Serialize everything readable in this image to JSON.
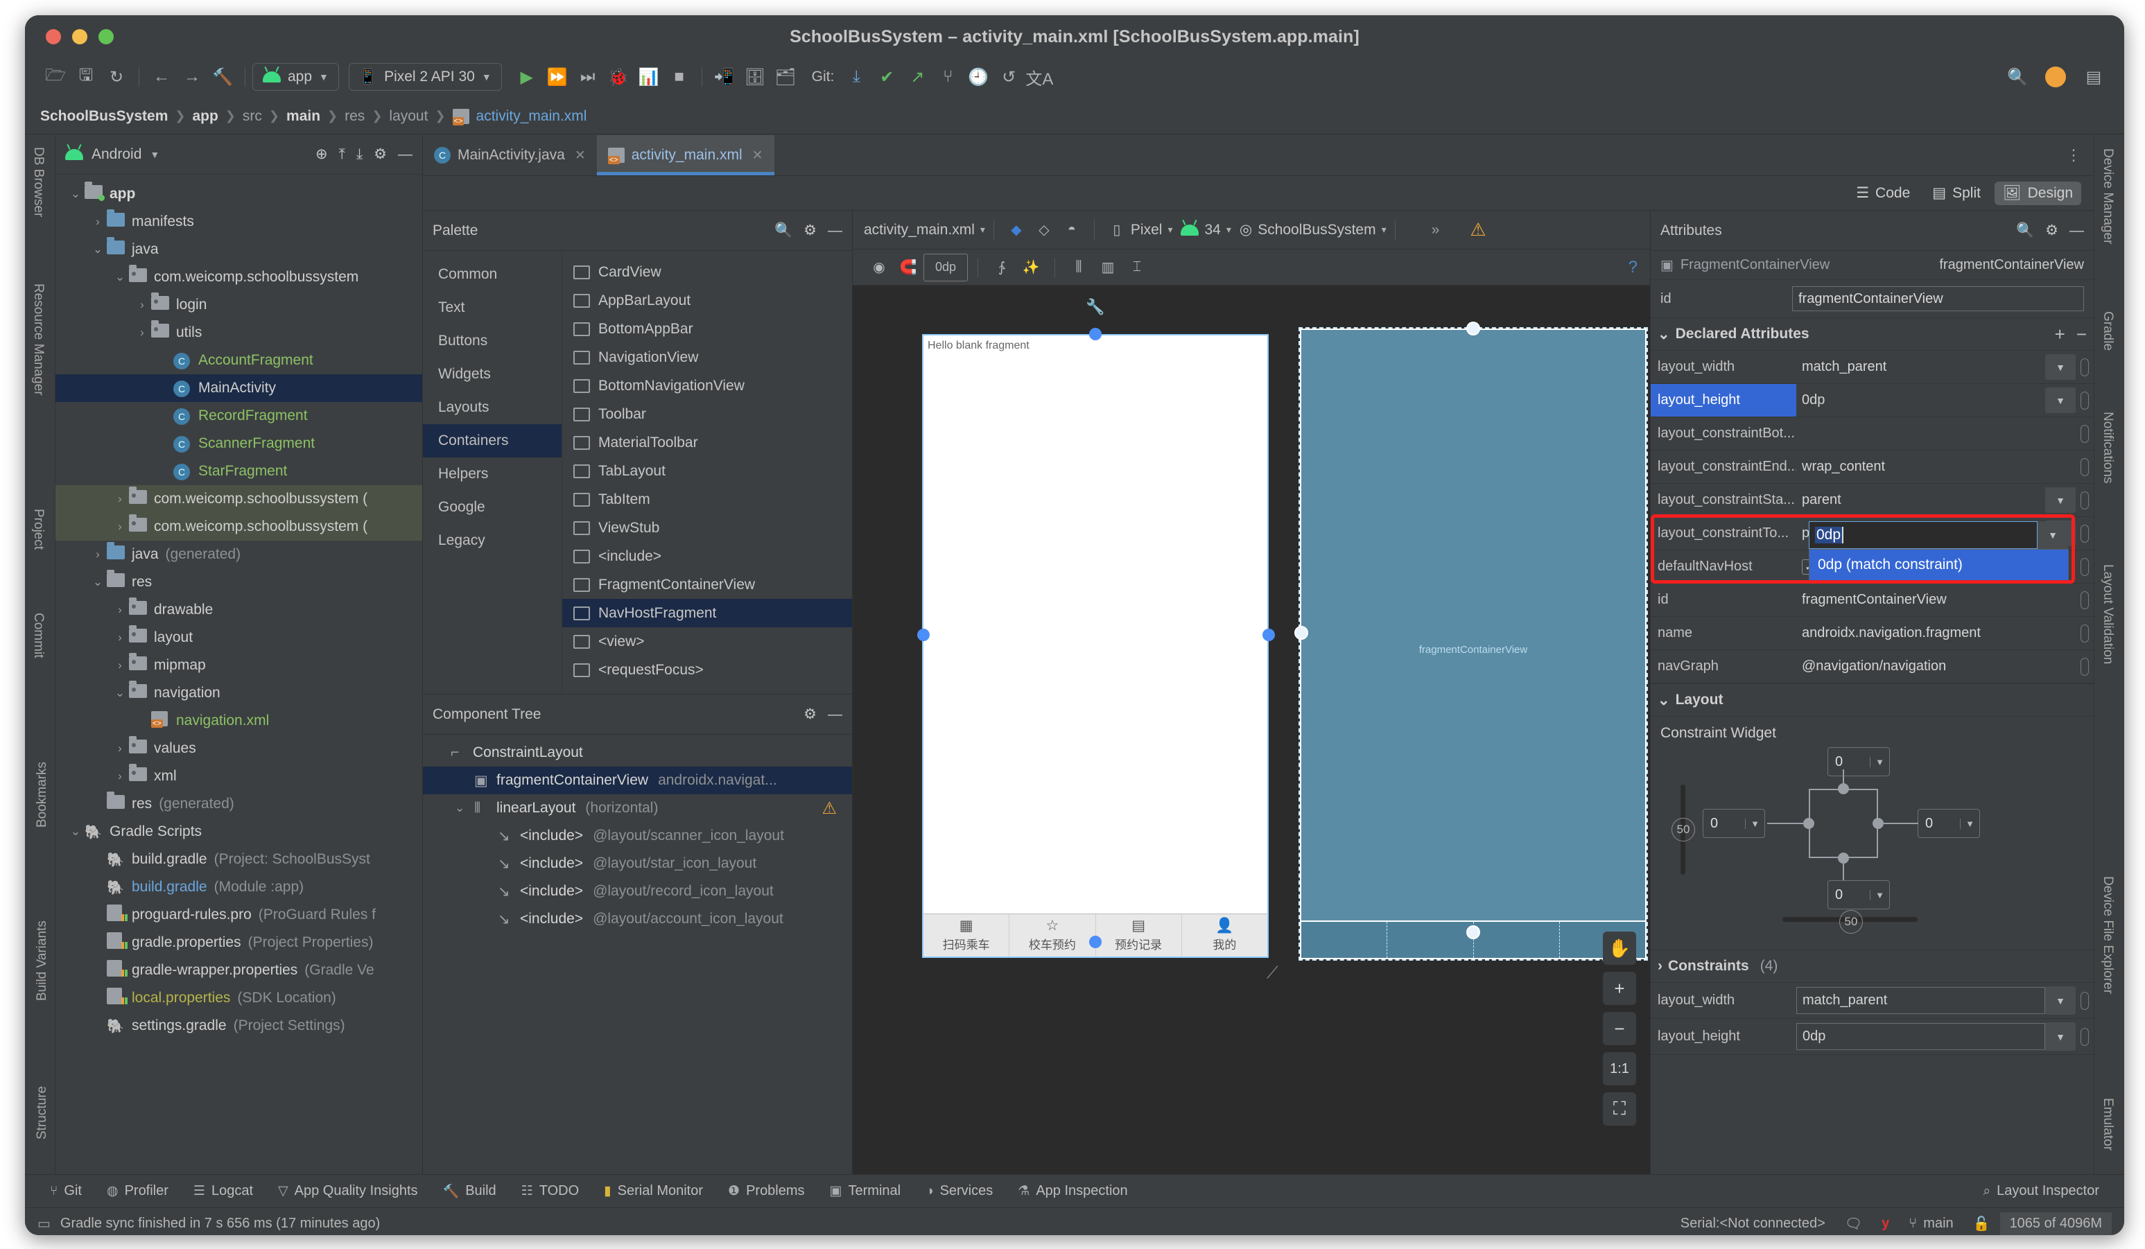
{
  "window": {
    "title": "SchoolBusSystem – activity_main.xml [SchoolBusSystem.app.main]"
  },
  "toolbar": {
    "icons": [
      "open-folder",
      "save",
      "sync"
    ],
    "nav": [
      "back",
      "forward",
      "build"
    ],
    "run_config": "app",
    "device": "Pixel 2 API 30",
    "git_label": "Git:",
    "memory": "1065 of 4096M"
  },
  "breadcrumb": {
    "items": [
      {
        "label": "SchoolBusSystem",
        "style": "bold"
      },
      {
        "label": "app",
        "style": "bold"
      },
      {
        "label": "src",
        "style": "normal"
      },
      {
        "label": "main",
        "style": "bold"
      },
      {
        "label": "res",
        "style": "normal"
      },
      {
        "label": "layout",
        "style": "normal"
      },
      {
        "label": "activity_main.xml",
        "style": "file"
      }
    ]
  },
  "project_panel": {
    "title": "Android",
    "tree": [
      {
        "indent": 0,
        "arrow": "v",
        "icon": "folder-module",
        "label": "app",
        "style": "bold",
        "sel": "none"
      },
      {
        "indent": 1,
        "arrow": ">",
        "icon": "folder",
        "label": "manifests",
        "style": "normal",
        "sel": "none"
      },
      {
        "indent": 1,
        "arrow": "v",
        "icon": "folder",
        "label": "java",
        "style": "normal",
        "sel": "none"
      },
      {
        "indent": 2,
        "arrow": "v",
        "icon": "package",
        "label": "com.weicomp.schoolbussystem",
        "style": "normal",
        "sel": "none"
      },
      {
        "indent": 3,
        "arrow": ">",
        "icon": "package",
        "label": "login",
        "style": "normal",
        "sel": "none"
      },
      {
        "indent": 3,
        "arrow": ">",
        "icon": "package",
        "label": "utils",
        "style": "normal",
        "sel": "none"
      },
      {
        "indent": 4,
        "arrow": "",
        "icon": "class",
        "label": "AccountFragment",
        "style": "green",
        "sel": "none"
      },
      {
        "indent": 4,
        "arrow": "",
        "icon": "class",
        "label": "MainActivity",
        "style": "normal",
        "sel": "blue"
      },
      {
        "indent": 4,
        "arrow": "",
        "icon": "class",
        "label": "RecordFragment",
        "style": "green",
        "sel": "none"
      },
      {
        "indent": 4,
        "arrow": "",
        "icon": "class",
        "label": "ScannerFragment",
        "style": "green",
        "sel": "none"
      },
      {
        "indent": 4,
        "arrow": "",
        "icon": "class",
        "label": "StarFragment",
        "style": "green",
        "sel": "none"
      },
      {
        "indent": 2,
        "arrow": ">",
        "icon": "package",
        "label": "com.weicomp.schoolbussystem (",
        "style": "normal",
        "sel": "green"
      },
      {
        "indent": 2,
        "arrow": ">",
        "icon": "package",
        "label": "com.weicomp.schoolbussystem (",
        "style": "normal",
        "sel": "green"
      },
      {
        "indent": 1,
        "arrow": ">",
        "icon": "folder-gen",
        "label": "java",
        "suffix": "(generated)",
        "style": "normal",
        "sel": "none"
      },
      {
        "indent": 1,
        "arrow": "v",
        "icon": "folder-res",
        "label": "res",
        "style": "normal",
        "sel": "none"
      },
      {
        "indent": 2,
        "arrow": ">",
        "icon": "package",
        "label": "drawable",
        "style": "normal",
        "sel": "none"
      },
      {
        "indent": 2,
        "arrow": ">",
        "icon": "package",
        "label": "layout",
        "style": "normal",
        "sel": "none"
      },
      {
        "indent": 2,
        "arrow": ">",
        "icon": "package",
        "label": "mipmap",
        "style": "normal",
        "sel": "none"
      },
      {
        "indent": 2,
        "arrow": "v",
        "icon": "package",
        "label": "navigation",
        "style": "normal",
        "sel": "none"
      },
      {
        "indent": 3,
        "arrow": "",
        "icon": "xml",
        "label": "navigation.xml",
        "style": "green",
        "sel": "none"
      },
      {
        "indent": 2,
        "arrow": ">",
        "icon": "package",
        "label": "values",
        "style": "normal",
        "sel": "none"
      },
      {
        "indent": 2,
        "arrow": ">",
        "icon": "package",
        "label": "xml",
        "style": "normal",
        "sel": "none"
      },
      {
        "indent": 1,
        "arrow": "",
        "icon": "folder-res",
        "label": "res",
        "suffix": "(generated)",
        "style": "normal",
        "sel": "none"
      },
      {
        "indent": 0,
        "arrow": "v",
        "icon": "gradle",
        "label": "Gradle Scripts",
        "style": "normal",
        "sel": "none"
      },
      {
        "indent": 1,
        "arrow": "",
        "icon": "gradle",
        "label": "build.gradle",
        "suffix": "(Project: SchoolBusSyst",
        "style": "normal",
        "sel": "none"
      },
      {
        "indent": 1,
        "arrow": "",
        "icon": "gradle",
        "label": "build.gradle",
        "suffix": "(Module :app)",
        "style": "blue",
        "sel": "none"
      },
      {
        "indent": 1,
        "arrow": "",
        "icon": "proguard",
        "label": "proguard-rules.pro",
        "suffix": "(ProGuard Rules f",
        "style": "normal",
        "sel": "none"
      },
      {
        "indent": 1,
        "arrow": "",
        "icon": "props",
        "label": "gradle.properties",
        "suffix": "(Project Properties)",
        "style": "normal",
        "sel": "none"
      },
      {
        "indent": 1,
        "arrow": "",
        "icon": "props",
        "label": "gradle-wrapper.properties",
        "suffix": "(Gradle Ve",
        "style": "normal",
        "sel": "none"
      },
      {
        "indent": 1,
        "arrow": "",
        "icon": "props",
        "label": "local.properties",
        "suffix": "(SDK Location)",
        "style": "olive",
        "sel": "none"
      },
      {
        "indent": 1,
        "arrow": "",
        "icon": "gradle",
        "label": "settings.gradle",
        "suffix": "(Project Settings)",
        "style": "normal",
        "sel": "none"
      }
    ]
  },
  "left_rail": [
    "DB Browser",
    "Resource Manager",
    "Project",
    "Commit",
    "Bookmarks",
    "Build Variants",
    "Structure"
  ],
  "right_rail": [
    "Device Manager",
    "Gradle",
    "Notifications",
    "Layout Validation",
    "Device File Explorer",
    "Emulator"
  ],
  "editor": {
    "tabs": [
      {
        "label": "MainActivity.java",
        "icon": "java-class-icon",
        "active": false
      },
      {
        "label": "activity_main.xml",
        "icon": "xml-file-icon",
        "active": true
      }
    ],
    "modes": [
      {
        "label": "Code",
        "active": false
      },
      {
        "label": "Split",
        "active": false
      },
      {
        "label": "Design",
        "active": true
      }
    ]
  },
  "palette": {
    "title": "Palette",
    "categories": [
      {
        "label": "Common",
        "active": false
      },
      {
        "label": "Text",
        "active": false
      },
      {
        "label": "Buttons",
        "active": false
      },
      {
        "label": "Widgets",
        "active": false
      },
      {
        "label": "Layouts",
        "active": false
      },
      {
        "label": "Containers",
        "active": true
      },
      {
        "label": "Helpers",
        "active": false
      },
      {
        "label": "Google",
        "active": false
      },
      {
        "label": "Legacy",
        "active": false
      }
    ],
    "items": [
      {
        "label": "CardView",
        "active": false
      },
      {
        "label": "AppBarLayout",
        "active": false
      },
      {
        "label": "BottomAppBar",
        "active": false
      },
      {
        "label": "NavigationView",
        "active": false
      },
      {
        "label": "BottomNavigationView",
        "active": false
      },
      {
        "label": "Toolbar",
        "active": false
      },
      {
        "label": "MaterialToolbar",
        "active": false
      },
      {
        "label": "TabLayout",
        "active": false
      },
      {
        "label": "TabItem",
        "active": false
      },
      {
        "label": "ViewStub",
        "active": false
      },
      {
        "label": "<include>",
        "active": false
      },
      {
        "label": "FragmentContainerView",
        "active": false
      },
      {
        "label": "NavHostFragment",
        "active": true
      },
      {
        "label": "<view>",
        "active": false
      },
      {
        "label": "<requestFocus>",
        "active": false
      }
    ]
  },
  "component_tree": {
    "title": "Component Tree",
    "rows": [
      {
        "indent": 0,
        "arrow": "",
        "icon": "constraint-icon",
        "label": "ConstraintLayout",
        "detail": "",
        "selected": false,
        "warn": false
      },
      {
        "indent": 1,
        "arrow": "",
        "icon": "fragment-icon",
        "label": "fragmentContainerView",
        "detail": "androidx.navigat...",
        "selected": true,
        "warn": false
      },
      {
        "indent": 1,
        "arrow": "v",
        "icon": "linear-icon",
        "label": "linearLayout",
        "detail": "(horizontal)",
        "selected": false,
        "warn": true
      },
      {
        "indent": 2,
        "arrow": "",
        "icon": "include-icon",
        "label": "<include>",
        "detail": "@layout/scanner_icon_layout",
        "selected": false,
        "warn": false
      },
      {
        "indent": 2,
        "arrow": "",
        "icon": "include-icon",
        "label": "<include>",
        "detail": "@layout/star_icon_layout",
        "selected": false,
        "warn": false
      },
      {
        "indent": 2,
        "arrow": "",
        "icon": "include-icon",
        "label": "<include>",
        "detail": "@layout/record_icon_layout",
        "selected": false,
        "warn": false
      },
      {
        "indent": 2,
        "arrow": "",
        "icon": "include-icon",
        "label": "<include>",
        "detail": "@layout/account_icon_layout",
        "selected": false,
        "warn": false
      }
    ]
  },
  "design_toolbar": {
    "file": "activity_main.xml",
    "device": "Pixel",
    "api": "34",
    "theme": "SchoolBusSystem",
    "overflow": "»",
    "default_margin": "0dp"
  },
  "preview": {
    "hello_text": "Hello blank fragment",
    "blueprint_label": "fragmentContainerView",
    "nav_items": [
      {
        "glyph": "scan",
        "label": "扫码乘车"
      },
      {
        "glyph": "star",
        "label": "校车预约"
      },
      {
        "glyph": "grid",
        "label": "预约记录"
      },
      {
        "glyph": "person",
        "label": "我的"
      }
    ],
    "zoom_reset": "1:1"
  },
  "attributes": {
    "title": "Attributes",
    "class_name": "FragmentContainerView",
    "instance_id": "fragmentContainerView",
    "id_key": "id",
    "id_value": "fragmentContainerView",
    "declared_title": "Declared Attributes",
    "rows": [
      {
        "key": "layout_width",
        "value": "match_parent",
        "dropdown": true,
        "highlight": false,
        "checkbox": false
      },
      {
        "key": "layout_height",
        "value": "0dp",
        "dropdown": true,
        "highlight": true,
        "checkbox": false
      },
      {
        "key": "layout_constraintBot...",
        "value": "",
        "dropdown": false,
        "highlight": false,
        "checkbox": false
      },
      {
        "key": "layout_constraintEnd...",
        "value": "wrap_content",
        "dropdown": false,
        "highlight": false,
        "checkbox": false
      },
      {
        "key": "layout_constraintSta...",
        "value": "parent",
        "dropdown": true,
        "highlight": false,
        "checkbox": false
      },
      {
        "key": "layout_constraintTo...",
        "value": "parent",
        "dropdown": true,
        "highlight": false,
        "checkbox": false
      },
      {
        "key": "defaultNavHost",
        "value": "true",
        "dropdown": false,
        "highlight": false,
        "checkbox": true
      },
      {
        "key": "id",
        "value": "fragmentContainerView",
        "dropdown": false,
        "highlight": false,
        "checkbox": false
      },
      {
        "key": "name",
        "value": "androidx.navigation.fragment",
        "dropdown": false,
        "highlight": false,
        "checkbox": false
      },
      {
        "key": "navGraph",
        "value": "@navigation/navigation",
        "dropdown": false,
        "highlight": false,
        "checkbox": false
      }
    ],
    "editing": {
      "field_value": "0dp",
      "option": "0dp (match constraint)"
    },
    "layout_title": "Layout",
    "constraint_widget_title": "Constraint Widget",
    "constraint_values": {
      "top": "0",
      "left": "0",
      "right": "0",
      "bottom": "0",
      "vbias": "50",
      "hbias": "50"
    },
    "constraints_title": "Constraints",
    "constraints_count": "(4)",
    "constraint_rows": [
      {
        "key": "layout_width",
        "value": "match_parent"
      },
      {
        "key": "layout_height",
        "value": "0dp"
      }
    ],
    "highlight_color": "#f41f1f"
  },
  "bottom_bar": {
    "items": [
      {
        "label": "Git",
        "icon": "git-icon"
      },
      {
        "label": "Profiler",
        "icon": "profiler-icon"
      },
      {
        "label": "Logcat",
        "icon": "logcat-icon"
      },
      {
        "label": "App Quality Insights",
        "icon": "insights-icon"
      },
      {
        "label": "Build",
        "icon": "build-icon"
      },
      {
        "label": "TODO",
        "icon": "todo-icon"
      },
      {
        "label": "Serial Monitor",
        "icon": "serial-icon"
      },
      {
        "label": "Problems",
        "icon": "problems-icon"
      },
      {
        "label": "Terminal",
        "icon": "terminal-icon"
      },
      {
        "label": "Services",
        "icon": "services-icon"
      },
      {
        "label": "App Inspection",
        "icon": "inspection-icon"
      }
    ],
    "right": {
      "label": "Layout Inspector",
      "icon": "layout-inspector-icon"
    }
  },
  "status_bar": {
    "message": "Gradle sync finished in 7 s 656 ms (17 minutes ago)",
    "serial": "Serial:<Not connected>",
    "branch": "main",
    "memory": "1065 of 4096M"
  }
}
